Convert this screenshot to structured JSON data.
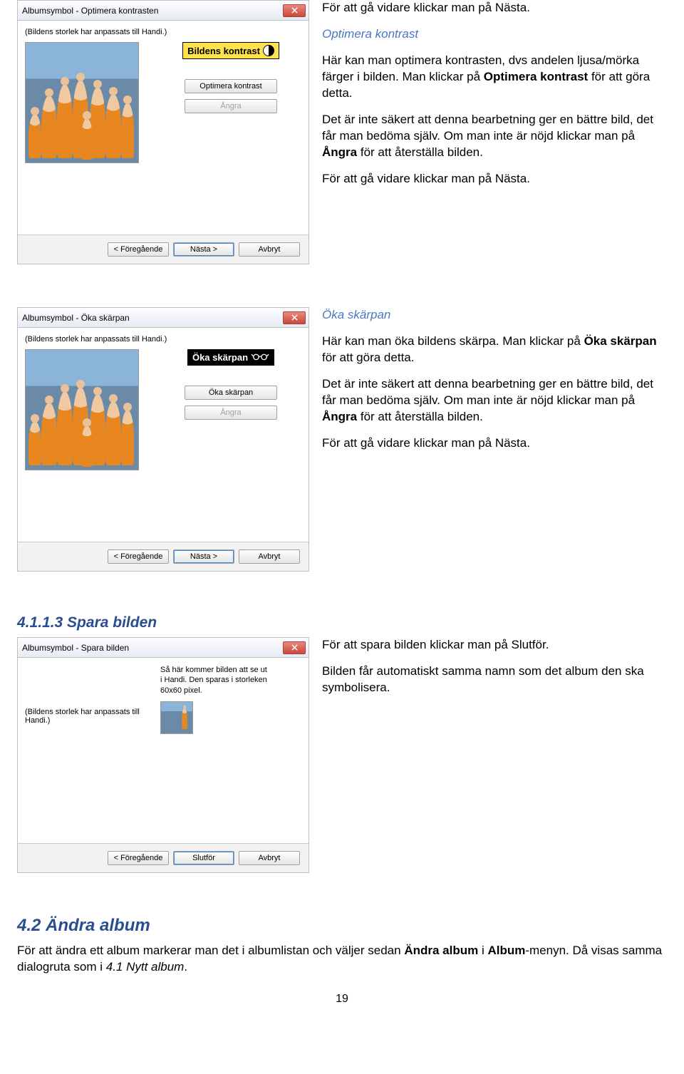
{
  "dialogs": {
    "contrast": {
      "title": "Albumsymbol - Optimera kontrasten",
      "hint": "(Bildens storlek har anpassats till Handi.)",
      "callout": "Bildens kontrast",
      "btn_action": "Optimera kontrast",
      "btn_undo": "Ångra",
      "btn_prev": "< Föregående",
      "btn_next": "Nästa >",
      "btn_cancel": "Avbryt"
    },
    "sharpen": {
      "title": "Albumsymbol - Öka skärpan",
      "hint": "(Bildens storlek har anpassats till Handi.)",
      "callout": "Öka skärpan",
      "btn_action": "Öka skärpan",
      "btn_undo": "Ångra",
      "btn_prev": "< Föregående",
      "btn_next": "Nästa >",
      "btn_cancel": "Avbryt"
    },
    "save": {
      "title": "Albumsymbol - Spara bilden",
      "hint": "(Bildens storlek har anpassats till Handi.)",
      "preview_text": "Så här kommer bilden att se ut i Handi. Den sparas i storleken 60x60 pixel.",
      "btn_prev": "< Föregående",
      "btn_finish": "Slutför",
      "btn_cancel": "Avbryt"
    }
  },
  "text": {
    "block1_p1": "För att gå vidare klickar man på Nästa.",
    "block1_h": "Optimera kontrast",
    "block1_p2a": "Här kan man optimera kontrasten, dvs andelen ljusa/mörka färger i bilden. Man klickar på ",
    "block1_p2b": "Optimera kontrast",
    "block1_p2c": " för att göra detta.",
    "block1_p3a": "Det är inte säkert att denna bearbetning ger en bättre bild, det får man bedöma själv. Om man inte är nöjd klickar man på ",
    "block1_p3b": "Ångra",
    "block1_p3c": " för att återställa bilden.",
    "block1_p4": "För att gå vidare klickar man på Nästa.",
    "block2_h": "Öka skärpan",
    "block2_p1a": "Här kan man öka bildens skärpa. Man klickar på ",
    "block2_p1b": "Öka skärpan",
    "block2_p1c": " för att göra detta.",
    "block2_p2a": "Det är inte säkert att denna bearbetning ger en bättre bild, det får man bedöma själv. Om man inte är nöjd klickar man på ",
    "block2_p2b": "Ångra",
    "block2_p2c": " för att återställa bilden.",
    "block2_p3": "För att gå vidare klickar man på Nästa.",
    "sec3_h": "4.1.1.3 Spara bilden",
    "block3_p1": "För att spara bilden klickar man på Slutför.",
    "block3_p2": "Bilden får automatiskt samma namn som det album den ska symbolisera.",
    "sec4_h": "4.2 Ändra album",
    "sec4_p1a": "För att ändra ett album markerar man det i albumlistan och väljer sedan ",
    "sec4_p1b": "Ändra album",
    "sec4_p1c": " i ",
    "sec4_p1d": "Album",
    "sec4_p1e": "-menyn. Då visas samma dialogruta som i ",
    "sec4_p1f": "4.1 Nytt album",
    "sec4_p1g": ".",
    "page_num": "19"
  }
}
